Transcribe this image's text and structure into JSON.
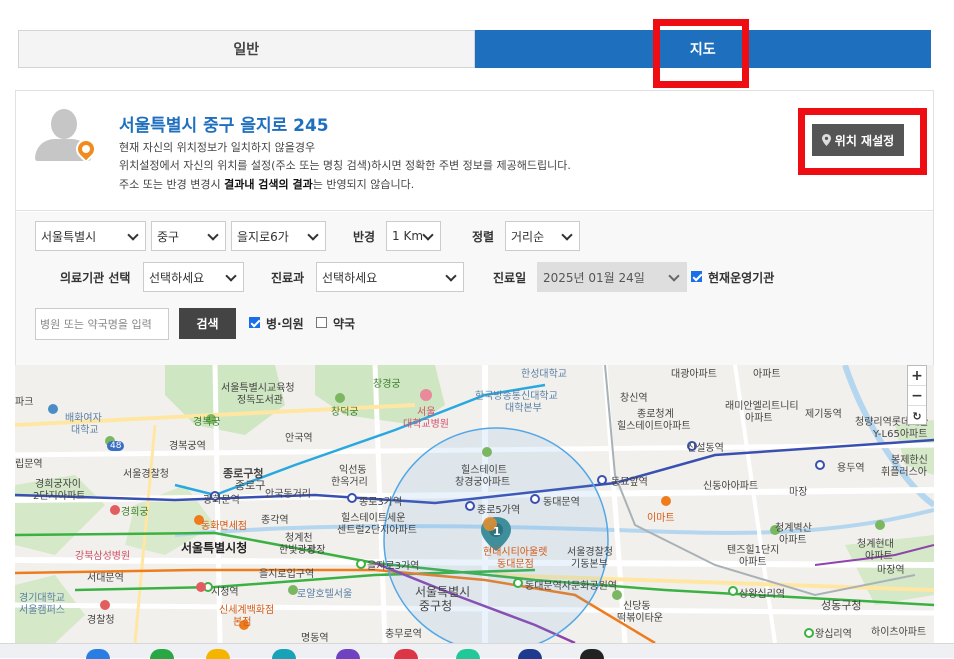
{
  "tabs": {
    "general": "일반",
    "map": "지도"
  },
  "location": {
    "address": "서울특별시 중구 을지로 245",
    "notice_line1": "현재 자신의 위치정보가 일치하지 않을경우",
    "notice_line2": "위치설정에서 자신의 위치를 설정(주소 또는 명칭 검색)하시면 정확한 주변 정보를 제공해드립니다.",
    "notice_line3_a": "주소 또는 반경 변경시 ",
    "notice_line3_b": "결과내 검색의 결과",
    "notice_line3_c": "는 반영되지 않습니다.",
    "reset_button": "위치 재설정"
  },
  "filters": {
    "city": "서울특별시",
    "district": "중구",
    "dong": "을지로6가",
    "radius_label": "반경",
    "radius": "1 Km",
    "sort_label": "정렬",
    "sort": "거리순",
    "institution_label": "의료기관 선택",
    "institution": "선택하세요",
    "department_label": "진료과",
    "department": "선택하세요",
    "date_label": "진료일",
    "date": "2025년 01월 24일",
    "operating_label": "현재운영기관",
    "operating_checked": true,
    "search_placeholder": "병원 또는 약국명을 입력",
    "search_button": "검색",
    "hospital_label": "병·의원",
    "hospital_checked": true,
    "pharmacy_label": "약국",
    "pharmacy_checked": false
  },
  "map": {
    "zoom_in": "+",
    "zoom_out": "−",
    "zoom_reset": "↻",
    "marker_count": "1",
    "labels": {
      "hansung": "한성대학교",
      "daegwang": "대광아파트",
      "apt1": "아파트",
      "seoul_edu": "서울특별시교육청",
      "jeongdok": "정독도서관",
      "changgyeonggung": "창경궁",
      "hanguk": "한국방송통신대학교",
      "daehak": "대학본부",
      "changsin": "창신역",
      "jongno_cheong": "종로청계",
      "hillstate1": "힐스테이트아파트",
      "raemian": "래미안엘리트니티",
      "apt2": "아파트",
      "jegi": "제기동역",
      "cheongnyang": "청량리역롯데캐슬",
      "y_l65": "Y-L65아파트",
      "pahwa": "파크",
      "baehwa": "배화여자",
      "daehakgyo": "대학교",
      "gyeongbok": "경복궁",
      "changdeok": "창덕궁",
      "seoul_hosp": "서울",
      "daehakgyobyeongwon": "대학교병원",
      "anguk": "안국역",
      "gyeongbokgung_st": "경복궁역",
      "sinseol": "신설동역",
      "yongdu": "용두역",
      "hwirei": "휘플러스아",
      "bomun": "봉제한신",
      "ripmun": "립문역",
      "seoul_police": "서울경찰청",
      "jongno_office": "종로구청",
      "iksun": "익선동",
      "hanok": "한옥거리",
      "hillstate2": "힐스테이트",
      "changgyeonggung_apt": "창경궁아파트",
      "dongmyo": "동묘앞역",
      "sindong": "신동아아파트",
      "majang": "마장",
      "gyeonghui_apt": "경희궁자이",
      "second_apt": "2단지아파트",
      "gwanghwamun": "광화문역",
      "anguk_street": "안국동거리",
      "jongno3": "종로3가역",
      "jongno5": "종로5가역",
      "dongdaemun": "동대문역",
      "gyeonghuigung": "경희궁",
      "jonggak": "종각역",
      "hillstate3": "힐스테이트세운",
      "central": "센트럴2단지아파트",
      "emart": "이마트",
      "cheonggye_byeoksan": "청계벽산",
      "apt3": "아파트",
      "cheonggye_hyundai": "청계현대",
      "apt4": "아파트",
      "donghwa": "동화면세점",
      "cheonggye_plaza": "청계천",
      "plaza": "한빛광장",
      "hyundai_city": "현대시티아울렛",
      "dongdaemun_st": "동대문점",
      "seoul_police2": "서울경찰청",
      "gidong": "기동본부",
      "tensquare": "텐즈힐1단지",
      "apt5": "아파트",
      "majang_st": "마장역",
      "gangbuk": "강북삼성병원",
      "seoul_cityhall": "서울특별시청",
      "euljiro3": "을지로3가역",
      "seodaemun": "서대문역",
      "euljiro_entrance": "을지로입구역",
      "dongdaemun_park": "동대문역사문화공원역",
      "sangwangsimni": "상왕십리역",
      "gyeonggi": "경기대학교",
      "seoul_campus": "서울캠퍼스",
      "city_hall_st": "시청역",
      "lotte": "로얄호텔서울",
      "seoul_metro": "서울특별시",
      "junggu": "중구청",
      "sindang": "신당동",
      "tteokbokki": "떡볶이타운",
      "seongdong": "성동구청",
      "shinsegae": "신세계백화점",
      "bonjeom": "본점",
      "police": "경찰청",
      "myeongdong": "명동역",
      "chungmuro": "충무로역",
      "wangsimni": "왕십리역",
      "hiz": "하이츠아파트",
      "jongno_palace": "종로구",
      "gwangjang": "광장",
      "line48": "48"
    }
  }
}
